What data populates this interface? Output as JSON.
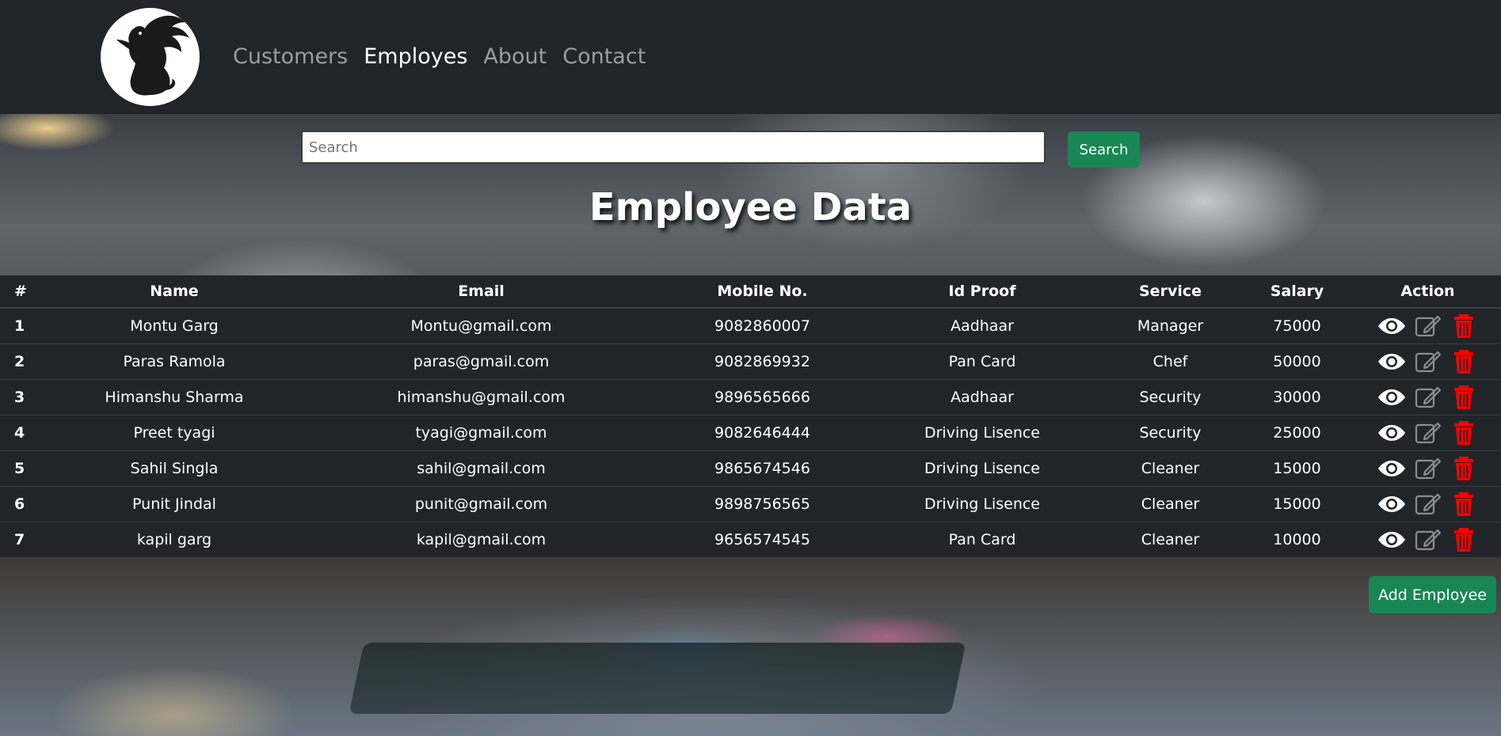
{
  "nav": {
    "links": [
      {
        "label": "Customers",
        "active": false
      },
      {
        "label": "Employes",
        "active": true
      },
      {
        "label": "About",
        "active": false
      },
      {
        "label": "Contact",
        "active": false
      }
    ]
  },
  "logo": {
    "icon": "griffin-logo-icon"
  },
  "search": {
    "placeholder": "Search",
    "value": "",
    "button_label": "Search"
  },
  "page_title": "Employee Data",
  "table": {
    "columns": [
      "#",
      "Name",
      "Email",
      "Mobile No.",
      "Id Proof",
      "Service",
      "Salary",
      "Action"
    ],
    "rows": [
      {
        "id": "1",
        "name": "Montu Garg",
        "email": "Montu@gmail.com",
        "mobile": "9082860007",
        "id_proof": "Aadhaar",
        "service": "Manager",
        "salary": "75000"
      },
      {
        "id": "2",
        "name": "Paras Ramola",
        "email": "paras@gmail.com",
        "mobile": "9082869932",
        "id_proof": "Pan Card",
        "service": "Chef",
        "salary": "50000"
      },
      {
        "id": "3",
        "name": "Himanshu Sharma",
        "email": "himanshu@gmail.com",
        "mobile": "9896565666",
        "id_proof": "Aadhaar",
        "service": "Security",
        "salary": "30000"
      },
      {
        "id": "4",
        "name": "Preet tyagi",
        "email": "tyagi@gmail.com",
        "mobile": "9082646444",
        "id_proof": "Driving Lisence",
        "service": "Security",
        "salary": "25000"
      },
      {
        "id": "5",
        "name": "Sahil Singla",
        "email": "sahil@gmail.com",
        "mobile": "9865674546",
        "id_proof": "Driving Lisence",
        "service": "Cleaner",
        "salary": "15000"
      },
      {
        "id": "6",
        "name": "Punit Jindal",
        "email": "punit@gmail.com",
        "mobile": "9898756565",
        "id_proof": "Driving Lisence",
        "service": "Cleaner",
        "salary": "15000"
      },
      {
        "id": "7",
        "name": "kapil garg",
        "email": "kapil@gmail.com",
        "mobile": "9656574545",
        "id_proof": "Pan Card",
        "service": "Cleaner",
        "salary": "10000"
      }
    ],
    "action_icons": [
      "eye-icon",
      "edit-icon",
      "trash-icon"
    ]
  },
  "add_button_label": "Add Employee",
  "colors": {
    "navbar_bg": "#212529",
    "table_bg": "#212529",
    "success_green": "#198754",
    "delete_red": "#ff0000",
    "edit_gray": "#8a8d91",
    "nav_inactive": "#9a9da1",
    "nav_active": "#ffffff"
  }
}
